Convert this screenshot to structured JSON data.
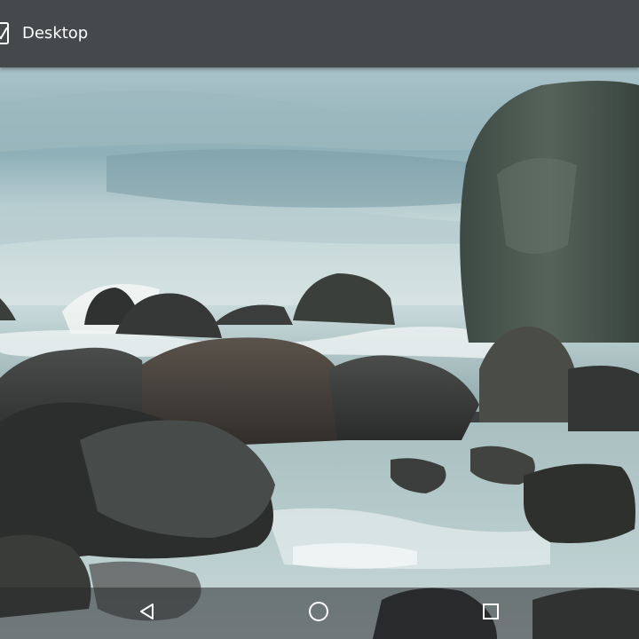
{
  "action_bar": {
    "title": "Desktop",
    "left_icon": "checkbox-check-icon",
    "background": "#46494b",
    "text_color": "#ffffff"
  },
  "wallpaper": {
    "subject": "rocky-shore-photo"
  },
  "nav_bar": {
    "back_icon": "back-triangle-icon",
    "home_icon": "home-circle-icon",
    "recents_icon": "recents-square-icon",
    "icon_color": "#ffffff"
  }
}
